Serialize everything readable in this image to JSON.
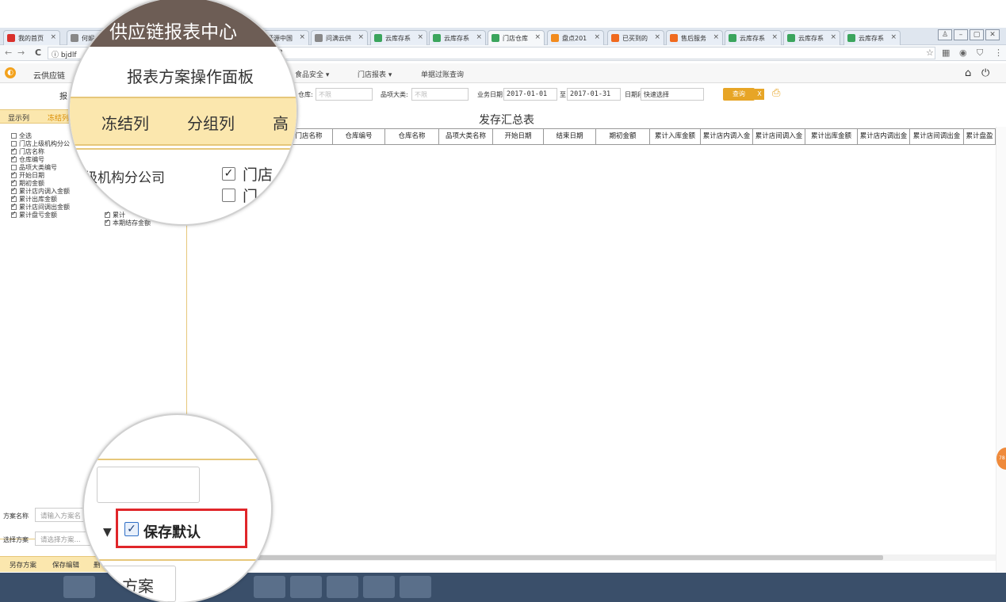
{
  "browser": {
    "tabs": [
      {
        "label": "我的首页",
        "color": "#d9302c"
      },
      {
        "label": "何妮",
        "color": "#888888"
      },
      {
        "label": "开源中国",
        "color": "#2aa5d0"
      },
      {
        "label": "问满云供",
        "color": "#888888"
      },
      {
        "label": "云库存系",
        "color": "#3ba55d"
      },
      {
        "label": "云库存系",
        "color": "#3ba55d"
      },
      {
        "label": "门店仓库",
        "color": "#3ba55d"
      },
      {
        "label": "盘点201",
        "color": "#f28b1e"
      },
      {
        "label": "已买到的",
        "color": "#f06a1e"
      },
      {
        "label": "售后服务",
        "color": "#f06a1e"
      },
      {
        "label": "云库存系",
        "color": "#3ba55d"
      },
      {
        "label": "云库存系",
        "color": "#3ba55d"
      },
      {
        "label": "云库存系",
        "color": "#3ba55d"
      }
    ],
    "close_glyph": "×",
    "url": "bjdlf",
    "url_suffix": "2",
    "back_icon": "←",
    "forward_icon": "→",
    "reload_icon": "C",
    "info_icon": "ⓘ",
    "star_icon": "☆",
    "menu_icon": "⋮"
  },
  "app": {
    "title": "云供应链",
    "logo_glyph": "◐",
    "menu": [
      {
        "label": "食品安全 ▾"
      },
      {
        "label": "门店报表 ▾"
      },
      {
        "label": "单据过账查询"
      }
    ],
    "home_icon": "⌂",
    "power_icon": "⏻"
  },
  "filters": {
    "warehouse_label": "仓库:",
    "warehouse_placeholder": "不限",
    "category_label": "品项大类:",
    "category_placeholder": "不限",
    "date_label": "业务日期:",
    "date_from": "2017-01-01",
    "to_label": "至",
    "date_to": "2017-01-31",
    "period_label": "日期段:",
    "period_value": "快速选择",
    "query_button": "查询",
    "excel_icon": "X",
    "print_icon": "⎙"
  },
  "left_panel": {
    "title": "报",
    "tabs": [
      "显示列",
      "冻结列"
    ],
    "checkboxes_left": [
      {
        "label": "全选",
        "checked": false
      },
      {
        "label": "门店上级机构分公",
        "checked": false
      },
      {
        "label": "门店名称",
        "checked": true
      },
      {
        "label": "仓库编号",
        "checked": true
      },
      {
        "label": "品项大类编号",
        "checked": false
      },
      {
        "label": "开始日期",
        "checked": true
      },
      {
        "label": "期初金额",
        "checked": true
      },
      {
        "label": "累计店内调入金额",
        "checked": true
      },
      {
        "label": "累计出库金额",
        "checked": true
      },
      {
        "label": "累计店间调出金额",
        "checked": true
      },
      {
        "label": "累计盘亏金额",
        "checked": true
      }
    ],
    "checkboxes_right": [
      {
        "label": "累计",
        "checked": true
      },
      {
        "label": "本期结存金额",
        "checked": true
      }
    ],
    "scheme_name_label": "方案名称",
    "scheme_name_placeholder": "请输入方案名",
    "select_scheme_label": "选择方案",
    "select_scheme_placeholder": "请选择方案...",
    "buttons": [
      "另存方案",
      "保存编辑",
      "删"
    ]
  },
  "report": {
    "title": "发存汇总表",
    "columns": [
      "门店名称",
      "仓库编号",
      "仓库名称",
      "品项大类名称",
      "开始日期",
      "结束日期",
      "期初金额",
      "累计入库金额",
      "累计店内调入金",
      "累计店间调入金",
      "累计出库金额",
      "累计店内调出金",
      "累计店间调出金",
      "累计盘盈"
    ]
  },
  "magnifier_top": {
    "title": "供应链报表中心",
    "panel_title": "报表方案操作面板",
    "tabs": [
      "冻结列",
      "分组列",
      "高"
    ],
    "org_label": "级机构分公司",
    "items": [
      {
        "label": "门店",
        "checked": true
      },
      {
        "label": "门",
        "checked": false
      }
    ]
  },
  "magnifier_bottom": {
    "dropdown_arrow": "▼",
    "save_default_label": "保存默认",
    "save_default_checked": true,
    "button_partial": "方案",
    "highlight_color": "#e0262a"
  },
  "side_badge": "78"
}
